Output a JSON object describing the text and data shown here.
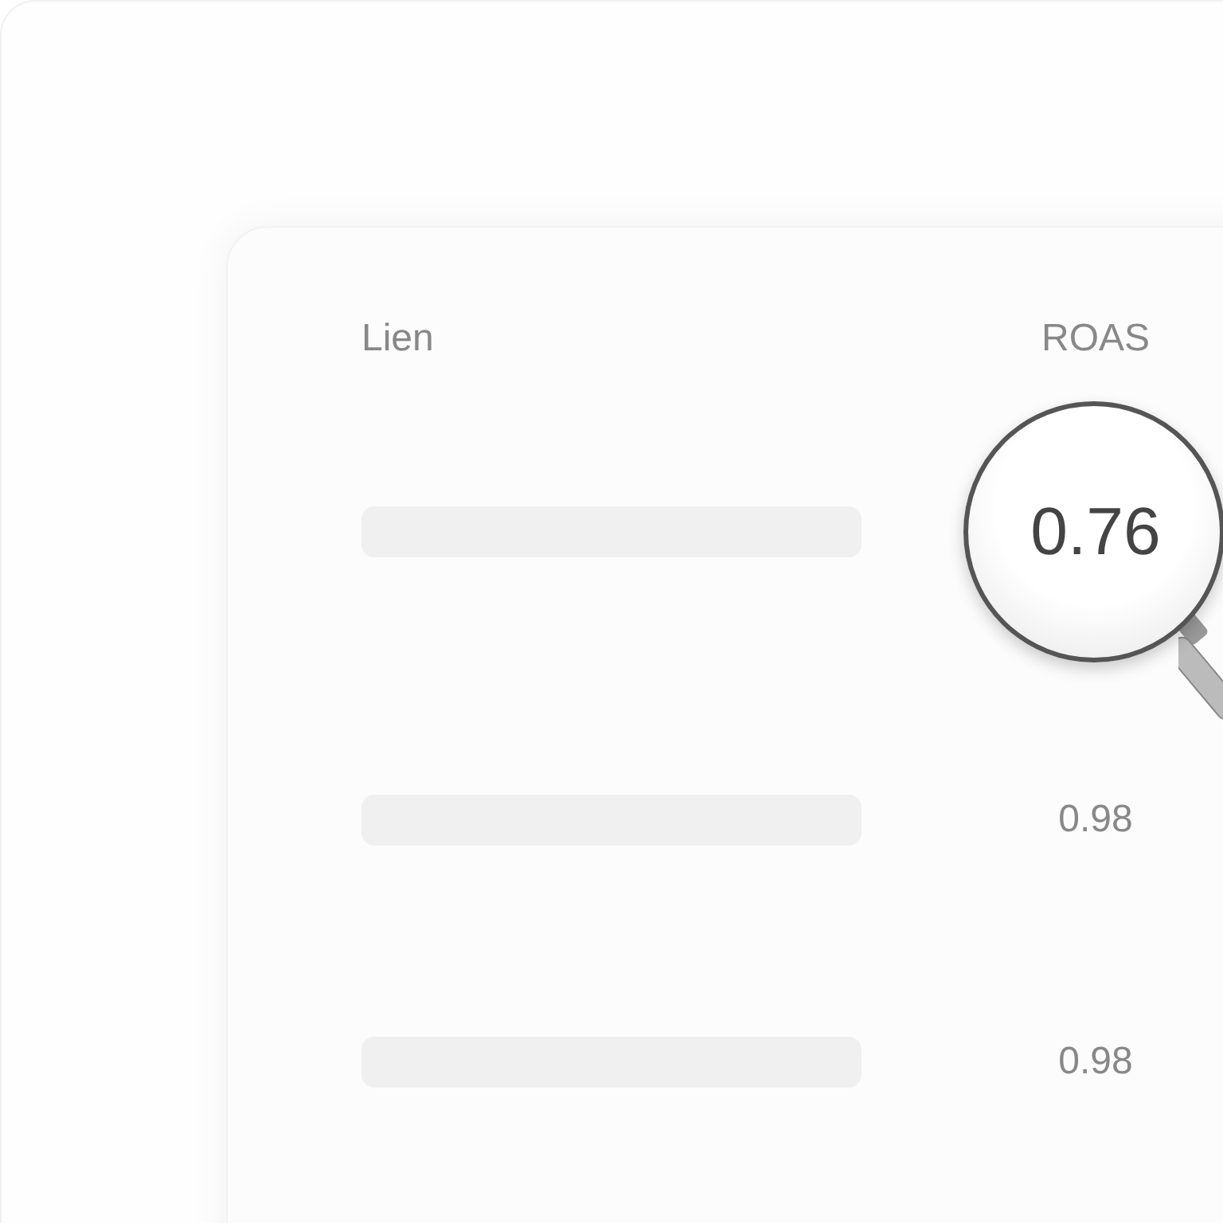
{
  "table": {
    "columns": [
      "Lien",
      "ROAS"
    ],
    "rows": [
      {
        "value": "0.76",
        "magnified": true
      },
      {
        "value": "0.98",
        "magnified": false
      },
      {
        "value": "0.98",
        "magnified": false
      }
    ]
  }
}
